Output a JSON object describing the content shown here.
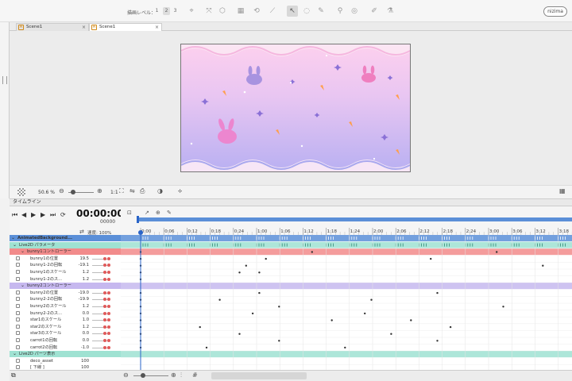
{
  "toolbar": {
    "level_label": "描画レベル：",
    "levels": [
      "1",
      "2",
      "3"
    ],
    "selected_level": "2",
    "nizima_label": "nizima"
  },
  "tabs": [
    {
      "label": "Scene1",
      "close": "×",
      "active": false
    },
    {
      "label": "Scene1",
      "close": "×",
      "active": true
    }
  ],
  "viewbar": {
    "zoom": "50.6 %",
    "scale": "1:1"
  },
  "timeline": {
    "tab_label": "タイムライン",
    "time": "00:00:00",
    "frame": "00000",
    "speed": "速度: 100%",
    "ticks": [
      "0:00",
      "0:06",
      "0:12",
      "0:18",
      "0:24",
      "1:00",
      "1:06",
      "1:12",
      "1:18",
      "1:24",
      "2:00",
      "2:06",
      "2:12",
      "2:18",
      "2:24",
      "3:00",
      "3:06",
      "3:12",
      "3:18"
    ]
  },
  "tree": {
    "root": "AnimatedBackground...",
    "group1": "Live2D パラメータ",
    "ctrl1": "bunny1コントローラー",
    "ctrl2": "bunny2コントローラー",
    "group2": "Live2D パーツ表示",
    "group3": "配置 & 不透明度",
    "rows": [
      {
        "name": "bunny1の位置",
        "value": "19.5",
        "color": "#ddd",
        "dots": [
          [
            20,
            "#e44"
          ],
          [
            24,
            "#e44"
          ]
        ]
      },
      {
        "name": "bunny1-2の回転",
        "value": "-19.1",
        "color": "#ddd",
        "dots": [
          [
            20,
            "#e44"
          ],
          [
            24,
            "#e44"
          ]
        ]
      },
      {
        "name": "bunny1のスケール",
        "value": "1.2",
        "color": "#ddd",
        "dots": [
          [
            20,
            "#e44"
          ],
          [
            24,
            "#e44"
          ]
        ]
      },
      {
        "name": "bunny1-2のス...",
        "value": "1.2",
        "color": "#ddd",
        "dots": [
          [
            20,
            "#e44"
          ],
          [
            24,
            "#e44"
          ]
        ]
      },
      {
        "name": "bunny2の位置",
        "value": "-19.0",
        "color": "#ddd",
        "dots": [
          [
            20,
            "#e44"
          ],
          [
            24,
            "#e44"
          ]
        ]
      },
      {
        "name": "bunny2-2の回転",
        "value": "-19.9",
        "color": "#ddd",
        "dots": [
          [
            20,
            "#e44"
          ],
          [
            24,
            "#e44"
          ]
        ]
      },
      {
        "name": "bunny2のスケール",
        "value": "1.2",
        "color": "#ddd",
        "dots": [
          [
            20,
            "#e44"
          ],
          [
            24,
            "#e44"
          ]
        ]
      },
      {
        "name": "bunny2-2のス...",
        "value": "0.0",
        "color": "#ddd",
        "dots": [
          [
            20,
            "#e44"
          ],
          [
            24,
            "#e44"
          ]
        ]
      },
      {
        "name": "star1のスケール",
        "value": "1.0",
        "color": "#ddd",
        "dots": [
          [
            20,
            "#e44"
          ],
          [
            24,
            "#e44"
          ]
        ]
      },
      {
        "name": "star2のスケール",
        "value": "1.2",
        "color": "#ddd",
        "dots": [
          [
            20,
            "#e44"
          ],
          [
            24,
            "#e44"
          ]
        ]
      },
      {
        "name": "star3のスケール",
        "value": "0.0",
        "color": "#ddd",
        "dots": [
          [
            20,
            "#e44"
          ],
          [
            24,
            "#e44"
          ]
        ]
      },
      {
        "name": "carrot1の回転",
        "value": "0.0",
        "color": "#ddd",
        "dots": [
          [
            20,
            "#e44"
          ],
          [
            24,
            "#e44"
          ]
        ]
      },
      {
        "name": "carrot2の回転",
        "value": "-1.0",
        "color": "#ddd",
        "dots": [
          [
            20,
            "#e44"
          ],
          [
            24,
            "#e44"
          ]
        ]
      },
      {
        "name": "deco_asset",
        "value": "100",
        "color": "#ddd",
        "dots": []
      },
      {
        "name": "[ 下線 ]",
        "value": "100",
        "color": "#ddd",
        "dots": []
      }
    ]
  },
  "colors": {
    "blue": "#5b8fd8",
    "teal": "#9fe2d2",
    "red": "#f28b8b",
    "purple": "#c6b8ef",
    "playhead": "#2a64c8"
  },
  "keyframes": [
    {
      "row": 2,
      "frames": [
        0,
        26,
        54
      ]
    },
    {
      "row": 3,
      "frames": [
        0,
        19,
        44
      ]
    },
    {
      "row": 4,
      "frames": [
        0,
        16,
        61
      ]
    },
    {
      "row": 5,
      "frames": [
        0,
        15,
        18
      ]
    },
    {
      "row": 6,
      "frames": [
        0,
        67
      ]
    },
    {
      "row": 8,
      "frames": [
        0,
        18,
        45
      ]
    },
    {
      "row": 9,
      "frames": [
        0,
        12,
        35
      ]
    },
    {
      "row": 10,
      "frames": [
        0,
        21,
        55
      ]
    },
    {
      "row": 11,
      "frames": [
        0,
        17,
        34
      ]
    },
    {
      "row": 12,
      "frames": [
        0,
        29,
        41
      ]
    },
    {
      "row": 13,
      "frames": [
        0,
        9,
        47
      ]
    },
    {
      "row": 14,
      "frames": [
        0,
        15,
        38
      ]
    },
    {
      "row": 15,
      "frames": [
        0,
        21,
        45
      ]
    },
    {
      "row": 16,
      "frames": [
        0,
        10,
        31
      ]
    }
  ]
}
